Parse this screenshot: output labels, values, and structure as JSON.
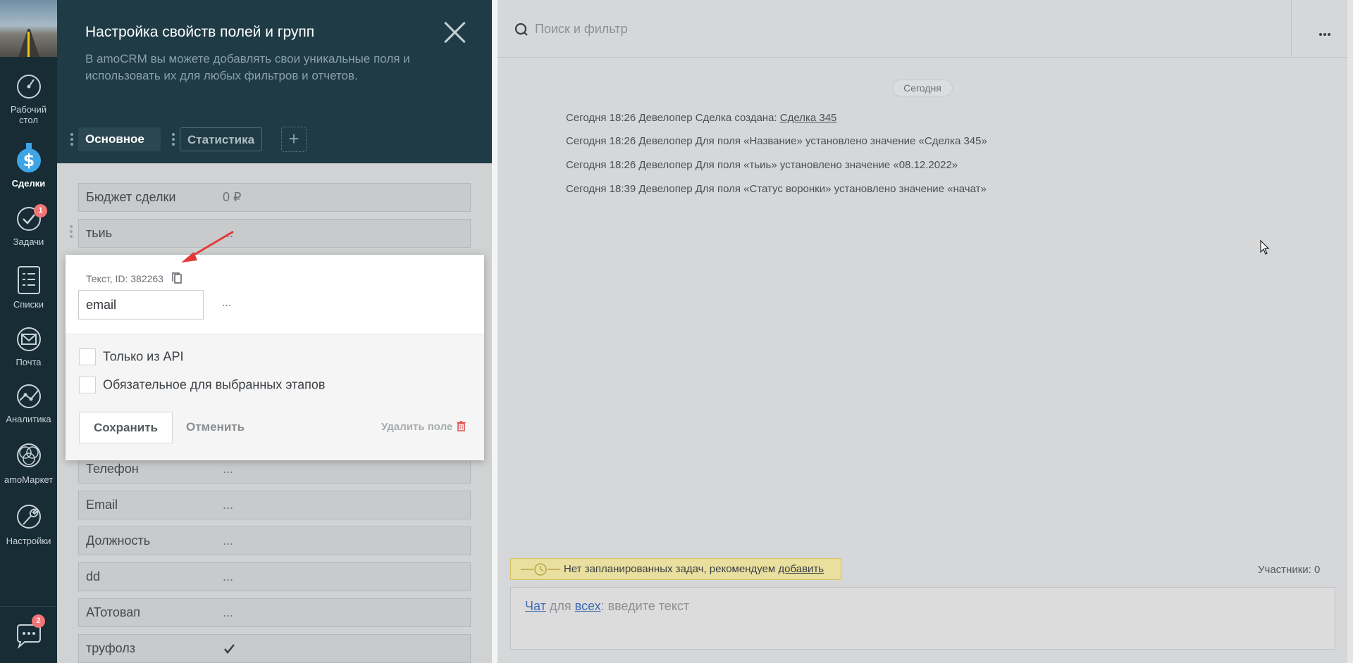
{
  "nav": {
    "items": [
      {
        "label_l1": "Рабочий",
        "label_l2": "стол"
      },
      {
        "label_l1": "Сделки",
        "label_l2": ""
      },
      {
        "label_l1": "Задачи",
        "label_l2": "",
        "badge": "1"
      },
      {
        "label_l1": "Списки",
        "label_l2": ""
      },
      {
        "label_l1": "Почта",
        "label_l2": ""
      },
      {
        "label_l1": "Аналитика",
        "label_l2": ""
      },
      {
        "label_l1": "amoМаркет",
        "label_l2": ""
      },
      {
        "label_l1": "Настройки",
        "label_l2": ""
      }
    ],
    "chat_badge": "2"
  },
  "panel": {
    "title": "Настройка свойств полей и групп",
    "description": "В amoCRM вы можете добавлять свои уникальные поля и использовать их для любых фильтров и отчетов.",
    "tabs": [
      {
        "label": "Основное"
      },
      {
        "label": "Статистика"
      }
    ],
    "add_tab": "+",
    "fields": [
      {
        "name": "Бюджет сделки",
        "value": "0 ₽"
      },
      {
        "name": "тьиь",
        "value": "..."
      },
      {
        "name": "Телефон",
        "value": "..."
      },
      {
        "name": "Email",
        "value": "..."
      },
      {
        "name": "Должность",
        "value": "..."
      },
      {
        "name": "dd",
        "value": "..."
      },
      {
        "name": "АТотовап",
        "value": "..."
      },
      {
        "name": "труфолз",
        "value": ""
      }
    ]
  },
  "popup": {
    "type_label": "Текст, ID: 382263",
    "input_value": "email",
    "more": "...",
    "option_api": "Только из API",
    "option_required": "Обязательное для выбранных этапов",
    "save": "Сохранить",
    "cancel": "Отменить",
    "delete": "Удалить поле"
  },
  "feed": {
    "search_placeholder": "Поиск и фильтр",
    "date_pill": "Сегодня",
    "events": [
      {
        "text": "Сегодня 18:26 Девелопер Сделка создана: ",
        "link": "Сделка 345"
      },
      {
        "text": "Сегодня 18:26 Девелопер Для поля «Название» установлено значение «Сделка 345»",
        "link": ""
      },
      {
        "text": "Сегодня 18:26 Девелопер Для поля «тьиь» установлено значение «08.12.2022»",
        "link": ""
      },
      {
        "text": "Сегодня 18:39 Девелопер Для поля «Статус воронки» установлено значение «начат»",
        "link": ""
      }
    ],
    "no_tasks_text": "Нет запланированных задач, рекомендуем ",
    "no_tasks_link": "добавить",
    "participants": "Участники: 0",
    "chat_link_1": "Чат",
    "chat_mid": " для ",
    "chat_link_2": "всех",
    "chat_placeholder": ": введите текст"
  },
  "colors": {
    "nav_bg": "#172c35",
    "panel_head_bg": "#1f3b45",
    "accent_red": "#e04b4b",
    "badge_red": "#f37575",
    "task_yellow": "#e9df9f"
  }
}
